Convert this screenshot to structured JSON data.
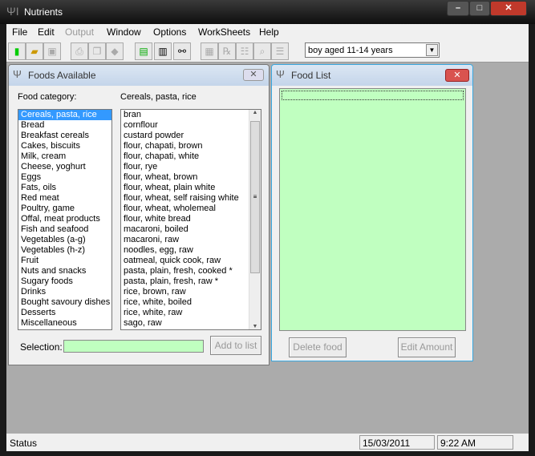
{
  "app": {
    "title": "Nutrients"
  },
  "menu": [
    "File",
    "Edit",
    "Output",
    "Window",
    "Options",
    "WorkSheets",
    "Help"
  ],
  "toolbar": {
    "profile": "boy aged 11-14 years"
  },
  "foods_available": {
    "title": "Foods Available",
    "category_label": "Food category:",
    "current_category": "Cereals, pasta, rice",
    "categories": [
      "Cereals, pasta, rice",
      "Bread",
      "Breakfast cereals",
      "Cakes, biscuits",
      "Milk, cream",
      "Cheese, yoghurt",
      "Eggs",
      "Fats, oils",
      "Red meat",
      "Poultry, game",
      "Offal, meat products",
      "Fish and seafood",
      "Vegetables (a-g)",
      "Vegetables (h-z)",
      "Fruit",
      "Nuts and snacks",
      "Sugary foods",
      "Drinks",
      "Bought savoury dishes",
      "Desserts",
      "Miscellaneous"
    ],
    "foods": [
      "bran",
      "cornflour",
      "custard powder",
      "flour, chapati, brown",
      "flour, chapati, white",
      "flour, rye",
      "flour, wheat, brown",
      "flour, wheat, plain white",
      "flour, wheat, self raising white",
      "flour, wheat, wholemeal",
      "flour, white bread",
      "macaroni, boiled",
      "macaroni, raw",
      "noodles, egg, raw",
      "oatmeal, quick cook, raw",
      "pasta, plain, fresh, cooked *",
      "pasta, plain, fresh, raw *",
      "rice, brown, raw",
      "rice, white, boiled",
      "rice, white, raw",
      "sago, raw"
    ],
    "selection_label": "Selection:",
    "selection_value": "",
    "add_button": "Add to list"
  },
  "food_list": {
    "title": "Food List",
    "delete_button": "Delete food",
    "edit_button": "Edit Amount"
  },
  "status": {
    "text": "Status",
    "date": "15/03/2011",
    "time": "9:22 AM"
  },
  "colors": {
    "green_field": "#c0ffc0",
    "selection": "#3399ff",
    "mdi_background": "#ababab"
  }
}
